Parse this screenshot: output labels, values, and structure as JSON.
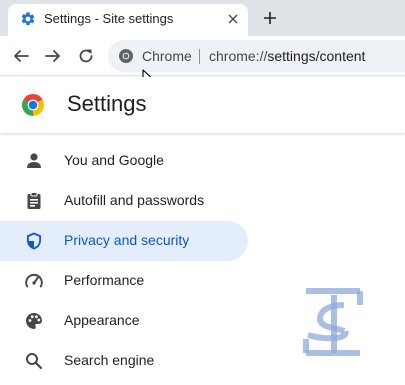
{
  "tab": {
    "title": "Settings - Site settings",
    "favicon": "gear-icon",
    "close_icon": "close-icon"
  },
  "new_tab_icon": "plus-icon",
  "toolbar": {
    "back_icon": "back-arrow-icon",
    "forward_icon": "forward-arrow-icon",
    "reload_icon": "reload-icon",
    "omnibox": {
      "chip_label": "Chrome",
      "url_prefix": "chrome://",
      "url_path": "settings/content"
    }
  },
  "settings": {
    "title": "Settings"
  },
  "sidebar": {
    "items": [
      {
        "label": "You and Google",
        "icon": "person-icon",
        "active": false
      },
      {
        "label": "Autofill and passwords",
        "icon": "clipboard-icon",
        "active": false
      },
      {
        "label": "Privacy and security",
        "icon": "shield-icon",
        "active": true
      },
      {
        "label": "Performance",
        "icon": "speedometer-icon",
        "active": false
      },
      {
        "label": "Appearance",
        "icon": "palette-icon",
        "active": false
      },
      {
        "label": "Search engine",
        "icon": "search-icon",
        "active": false
      }
    ]
  },
  "colors": {
    "accent": "#0b57d0",
    "active_bg": "#e3edfb",
    "icon": "#474747",
    "tabstrip": "#dfe3e8"
  }
}
